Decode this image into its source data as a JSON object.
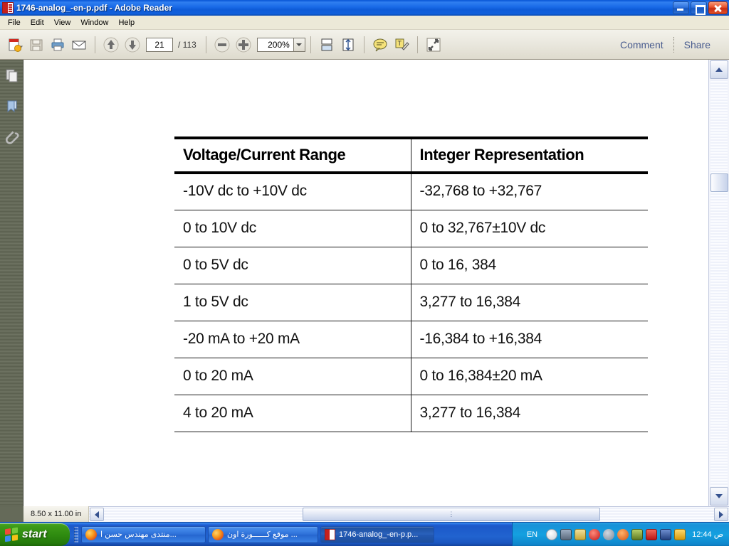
{
  "window": {
    "title": "1746-analog_-en-p.pdf - Adobe Reader",
    "app_icon": "pdf-document-icon",
    "minimize_label": "Minimize",
    "restore_label": "Restore",
    "close_label": "Close"
  },
  "menu": {
    "items": [
      {
        "label": "File"
      },
      {
        "label": "Edit"
      },
      {
        "label": "View"
      },
      {
        "label": "Window"
      },
      {
        "label": "Help"
      }
    ]
  },
  "toolbar": {
    "buttons": [
      {
        "name": "create-pdf-icon",
        "glyph": "➕"
      },
      {
        "name": "save-icon",
        "glyph": "💾"
      },
      {
        "name": "print-icon",
        "glyph": "🖨"
      },
      {
        "name": "email-icon",
        "glyph": "✉"
      },
      {
        "name": "previous-page-icon",
        "glyph": "↑"
      },
      {
        "name": "next-page-icon",
        "glyph": "↓"
      },
      {
        "name": "zoom-out-icon",
        "glyph": "−"
      },
      {
        "name": "zoom-in-icon",
        "glyph": "＋"
      },
      {
        "name": "fit-width-icon",
        "glyph": "⬌"
      },
      {
        "name": "fit-page-icon",
        "glyph": "⬍"
      },
      {
        "name": "sticky-note-icon",
        "glyph": "💬"
      },
      {
        "name": "highlight-text-icon",
        "glyph": "🖍"
      },
      {
        "name": "read-mode-icon",
        "glyph": "⤡"
      }
    ],
    "page_number": "21",
    "page_total": "/ 113",
    "zoom_level": "200%",
    "zoom_dropdown": "chevron-down-icon",
    "comment_label": "Comment",
    "share_label": "Share"
  },
  "nav_pane": {
    "items": [
      {
        "name": "page-thumbnails-icon",
        "label": "Page Thumbnails"
      },
      {
        "name": "bookmarks-icon",
        "label": "Bookmarks"
      },
      {
        "name": "attachments-icon",
        "label": "Attachments"
      }
    ]
  },
  "document": {
    "table": {
      "headers": [
        "Voltage/Current Range",
        "Integer Representation"
      ],
      "rows": [
        [
          "-10V dc to +10V dc",
          "-32,768 to +32,767"
        ],
        [
          "0 to 10V dc",
          "0 to 32,767±10V dc"
        ],
        [
          "0 to 5V dc",
          "0 to 16, 384"
        ],
        [
          "1 to 5V dc",
          "3,277 to 16,384"
        ],
        [
          "-20 mA to +20 mA",
          "-16,384 to +16,384"
        ],
        [
          "0 to 20 mA",
          "0 to 16,384±20 mA"
        ],
        [
          "4 to 20 mA",
          "3,277 to 16,384"
        ]
      ]
    }
  },
  "status_bar": {
    "page_size": "8.50 x 11.00 in"
  },
  "scrollbars": {
    "vertical_up": "scroll-up-arrow",
    "vertical_down": "scroll-down-arrow",
    "horizontal_left": "scroll-left-arrow",
    "horizontal_right": "scroll-right-arrow",
    "grip": "⋮"
  },
  "taskbar": {
    "start_label": "start",
    "items": [
      {
        "icon": "firefox-icon",
        "label": "منتدى مهندس حسن ا...",
        "active": false
      },
      {
        "icon": "firefox-icon",
        "label": "موقع كــــــورة اون ...",
        "active": false
      },
      {
        "icon": "pdf-document-icon",
        "label": "1746-analog_-en-p.p...",
        "active": true
      }
    ],
    "language": "EN",
    "tray_icons": [
      {
        "name": "messenger-icon",
        "color": "#e9eef4"
      },
      {
        "name": "network-icon",
        "color": "#6f7d90"
      },
      {
        "name": "printer-icon",
        "color": "#d8c86a"
      },
      {
        "name": "safely-remove-icon",
        "color": "#d32424"
      },
      {
        "name": "volume-muted-icon",
        "color": "#8e9bab"
      },
      {
        "name": "speaker-icon",
        "color": "#e0641b"
      },
      {
        "name": "download-manager-icon",
        "color": "#7e9a3c"
      },
      {
        "name": "antivirus-icon",
        "color": "#d32424"
      },
      {
        "name": "display-settings-icon",
        "color": "#2a4f9e"
      },
      {
        "name": "tweak-icon",
        "color": "#e8b01c"
      }
    ],
    "clock": "12:44 ص"
  },
  "colors": {
    "titlebar_blue": "#1b6ce8",
    "toolbar_gray": "#e9e7dd",
    "link_blue": "#4a5d8f",
    "taskbar_blue": "#2163cf",
    "start_green": "#2f8c10",
    "page_white": "#ffffff",
    "table_rule": "#1a1a1a"
  }
}
